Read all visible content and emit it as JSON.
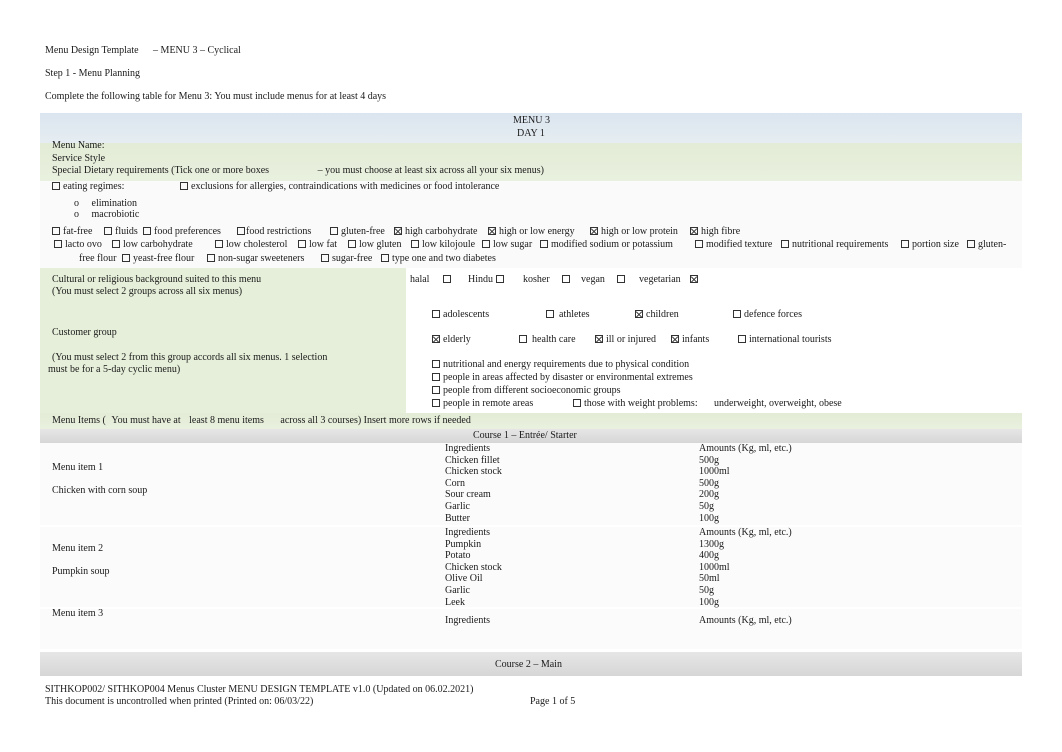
{
  "header": {
    "title": "Menu Design Template",
    "subtitle": "– MENU 3  – Cyclical",
    "step": "Step 1 - Menu Planning",
    "instruction": "Complete the following table for Menu 3: You must include menus for at least 4 days"
  },
  "table": {
    "menu_label": "MENU 3",
    "day_label": "DAY 1",
    "menu_name_label": "Menu Name:",
    "service_style_label": "Service Style",
    "dietary": {
      "label": "Special Dietary requirements (Tick one or more boxes",
      "note": "–  you must choose at least six across all your six menus)",
      "eating_regimes": "eating regimes:",
      "exclusions": "exclusions for allergies, contraindications with medicines or food intolerance",
      "regime_bullet": "o",
      "regimes": [
        "elimination",
        "macrobiotic"
      ],
      "row1": [
        {
          "label": "fat-free",
          "checked": false
        },
        {
          "label": "fluids",
          "checked": false
        },
        {
          "label": "food preferences",
          "checked": false
        },
        {
          "label": "food restrictions",
          "checked": false
        },
        {
          "label": "gluten-free",
          "checked": false
        },
        {
          "label": "high carbohydrate",
          "checked": true
        },
        {
          "label": "high or low energy",
          "checked": true
        },
        {
          "label": "high or low protein",
          "checked": true
        },
        {
          "label": "high fibre",
          "checked": true
        }
      ],
      "row2": [
        {
          "label": "lacto ovo",
          "checked": false
        },
        {
          "label": "low carbohydrate",
          "checked": false
        },
        {
          "label": "low cholesterol",
          "checked": false
        },
        {
          "label": "low fat",
          "checked": false
        },
        {
          "label": "low gluten",
          "checked": false
        },
        {
          "label": "low kilojoule",
          "checked": false
        },
        {
          "label": "low sugar",
          "checked": false
        },
        {
          "label": "modified sodium or potassium",
          "checked": false
        },
        {
          "label": "modified texture",
          "checked": false
        },
        {
          "label": "nutritional requirements",
          "checked": false
        },
        {
          "label": "portion size",
          "checked": false
        },
        {
          "label": "gluten-",
          "checked": false
        }
      ],
      "row3_prefix": "free flour",
      "row3": [
        {
          "label": "yeast-free flour",
          "checked": false
        },
        {
          "label": "non-sugar sweeteners",
          "checked": false
        },
        {
          "label": "sugar-free",
          "checked": false
        },
        {
          "label": "type one and two diabetes",
          "checked": false
        }
      ]
    },
    "cultural": {
      "label": "Cultural or religious background suited to this menu",
      "note": "(You must select 2 groups across all six menus)",
      "options": [
        {
          "label": "halal",
          "checked": false
        },
        {
          "label": "Hindu",
          "checked": false
        },
        {
          "label": "kosher",
          "checked": false
        },
        {
          "label": "vegan",
          "checked": false
        },
        {
          "label": "vegetarian",
          "checked": true
        }
      ]
    },
    "customer": {
      "label": "Customer group",
      "note_line1": "(You must select 2 from this group accords all six menus. 1 selection",
      "note_line2": "must be for a 5-day cyclic menu)",
      "row1": [
        {
          "label": "adolescents",
          "checked": false
        },
        {
          "label": "athletes",
          "checked": false
        },
        {
          "label": "children",
          "checked": true
        },
        {
          "label": "defence forces",
          "checked": false
        }
      ],
      "row2": [
        {
          "label": "elderly",
          "checked": true
        },
        {
          "label": "health care",
          "checked": false
        },
        {
          "label": "ill or injured",
          "checked": true
        },
        {
          "label": "infants",
          "checked": true
        },
        {
          "label": "international tourists",
          "checked": false
        }
      ],
      "row3": {
        "label": "nutritional and energy requirements due to physical condition",
        "checked": false
      },
      "row4": {
        "label": "people in areas affected by disaster or environmental extremes",
        "checked": false
      },
      "row5": {
        "label": "people from different socioeconomic groups",
        "checked": false
      },
      "row6": [
        {
          "label": "people in remote areas",
          "checked": false
        },
        {
          "label": "those with weight problems:",
          "checked": false
        }
      ],
      "row6_suffix": "underweight, overweight, obese"
    },
    "menu_items_header": {
      "part1": "Menu Items (",
      "part2": "You must have at",
      "part3": "least 8 menu items",
      "part4": "across all 3 courses) Insert more rows if needed"
    },
    "course1_label": "Course 1  – Entrée/ Starter",
    "course2_label": "Course 2   – Main",
    "ingredients_header": "Ingredients",
    "amounts_header": "Amounts (Kg, ml, etc.)",
    "items": [
      {
        "label": "Menu item 1",
        "name": "Chicken with corn soup",
        "ingredients": [
          "Chicken fillet",
          "Chicken stock",
          "Corn",
          "Sour cream",
          "Garlic",
          "Butter"
        ],
        "amounts": [
          "500g",
          "1000ml",
          "500g",
          "200g",
          "50g",
          "100g"
        ]
      },
      {
        "label": "Menu item 2",
        "name": "Pumpkin soup",
        "ingredients": [
          "Pumpkin",
          "Potato",
          "Chicken stock",
          "Olive Oil",
          "Garlic",
          "Leek"
        ],
        "amounts": [
          "1300g",
          "400g",
          "1000ml",
          "50ml",
          "50g",
          "100g"
        ]
      },
      {
        "label": "Menu item 3",
        "name": "",
        "ingredients": [],
        "amounts": []
      }
    ]
  },
  "footer": {
    "doc_ref": "SITHKOP002/ SITHKOP004 Menus Cluster MENU DESIGN TEMPLATE v1.0 (Updated on 06.02.2021)",
    "printed_note": "This document is uncontrolled when printed (Printed on: 06/03/22)",
    "page": "Page 1 of 5"
  }
}
